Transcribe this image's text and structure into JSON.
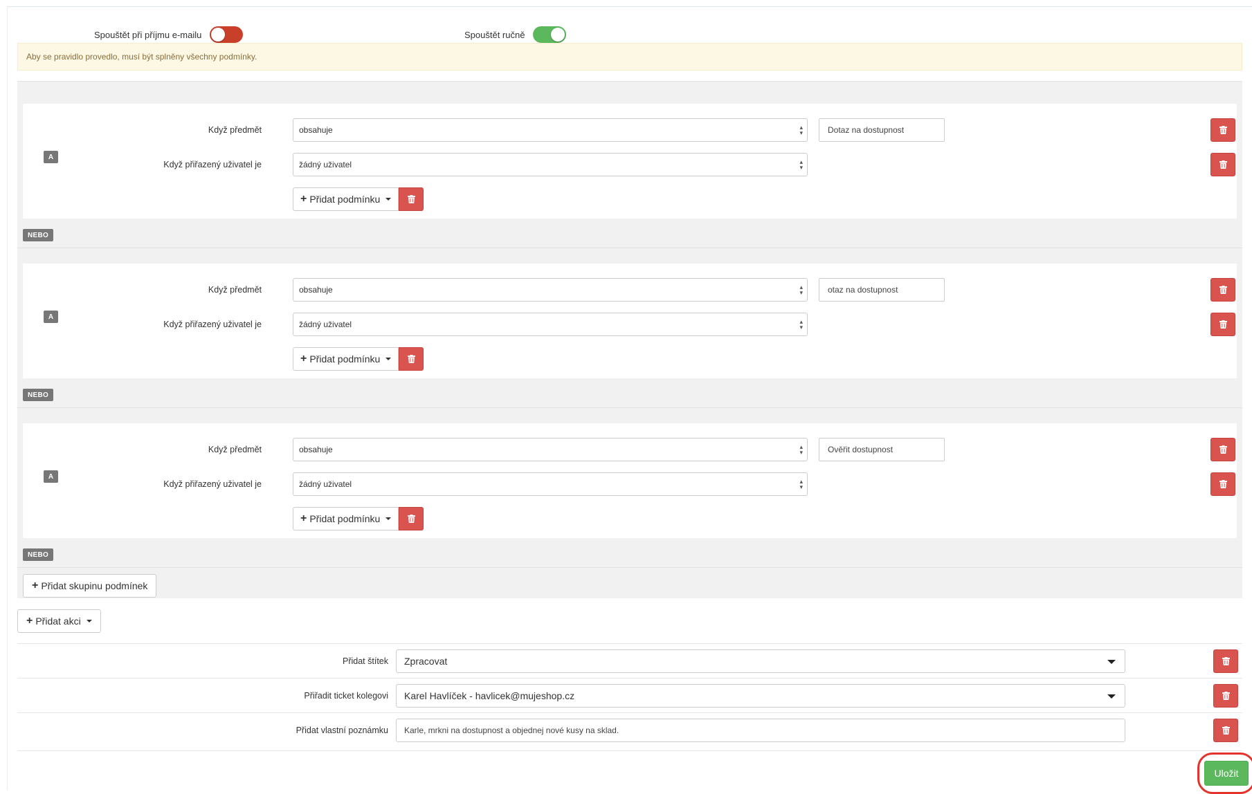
{
  "toggles": {
    "email_label": "Spouštět při příjmu e-mailu",
    "email_state": "off",
    "manual_label": "Spouštět ručně",
    "manual_state": "on"
  },
  "alert": "Aby se pravidlo provedlo, musí být splněny všechny podmínky.",
  "groups": [
    {
      "badge": "A",
      "conditions": [
        {
          "label": "Když předmět",
          "operator": "obsahuje",
          "value": "Dotaz na dostupnost"
        },
        {
          "label": "Když přiřazený uživatel je",
          "operator": "žádný uživatel"
        }
      ],
      "add_condition_label": "Přidat podmínku"
    },
    {
      "badge": "A",
      "conditions": [
        {
          "label": "Když předmět",
          "operator": "obsahuje",
          "value": "otaz na dostupnost"
        },
        {
          "label": "Když přiřazený uživatel je",
          "operator": "žádný uživatel"
        }
      ],
      "add_condition_label": "Přidat podmínku"
    },
    {
      "badge": "A",
      "conditions": [
        {
          "label": "Když předmět",
          "operator": "obsahuje",
          "value": "Ověřit dostupnost"
        },
        {
          "label": "Když přiřazený uživatel je",
          "operator": "žádný uživatel"
        }
      ],
      "add_condition_label": "Přidat podmínku"
    }
  ],
  "or_label": "NEBO",
  "add_group_label": "Přidat skupinu podmínek",
  "add_action_label": "Přidat akci",
  "actions": [
    {
      "label": "Přidat štítek",
      "value": "Zpracovat"
    },
    {
      "label": "Přiřadit ticket kolegovi",
      "value": "Karel Havlíček - havlicek@mujeshop.cz"
    },
    {
      "label": "Přidat vlastní poznámku",
      "value": "Karle, mrkni na dostupnost a objednej nové kusy na sklad."
    }
  ],
  "save_label": "Uložit",
  "colors": {
    "danger": "#d9534f",
    "success": "#5cb85c",
    "toggle_off": "#c9402a",
    "highlight": "#e2332c"
  }
}
